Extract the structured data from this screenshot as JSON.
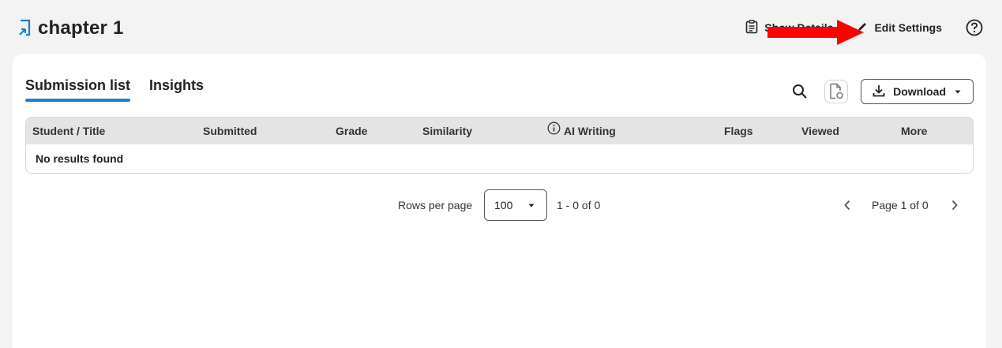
{
  "header": {
    "title": "chapter 1",
    "show_details_label": "Show Details",
    "edit_settings_label": "Edit Settings"
  },
  "tabs": [
    {
      "label": "Submission list",
      "active": true
    },
    {
      "label": "Insights",
      "active": false
    }
  ],
  "toolbar": {
    "download_label": "Download"
  },
  "table": {
    "columns": [
      "Student / Title",
      "Submitted",
      "Grade",
      "Similarity",
      "AI Writing",
      "Flags",
      "Viewed",
      "More"
    ],
    "empty_message": "No results found"
  },
  "pagination": {
    "rows_label": "Rows per page",
    "rows_value": "100",
    "range": "1 - 0 of 0",
    "page": "Page 1 of 0"
  },
  "colors": {
    "accent": "#1a7fd4",
    "arrow": "#ff0000"
  }
}
